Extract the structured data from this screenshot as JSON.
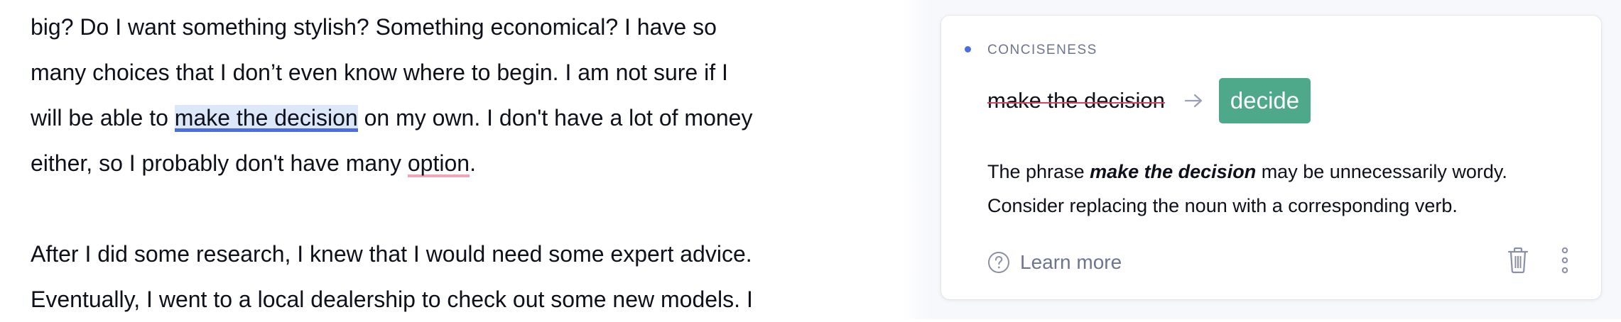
{
  "editor": {
    "paragraph1": {
      "line1": "big? Do I want something stylish? Something economical? I have so",
      "line2": "many choices that I don’t even know where to begin. I am not sure if I",
      "line3_before": "will be able to ",
      "line3_highlight": "make the decision",
      "line3_after": " on my own. I don't have a lot of money",
      "line4_before": "either, so I probably don't have many ",
      "line4_highlight": "option",
      "line4_after": "."
    },
    "paragraph2": {
      "line1": "After I did some research, I knew that I would need some expert advice.",
      "line2": "Eventually, I went to a local dealership to check out some new models. I"
    }
  },
  "card": {
    "category": "CONCISENESS",
    "category_color": "#4a6ee0",
    "original_text": "make the decision",
    "replacement_text": "decide",
    "replacement_color": "#4ea88a",
    "explanation_prefix": "The phrase ",
    "explanation_phrase": "make the decision",
    "explanation_suffix": " may be unnecessarily wordy.",
    "explanation_line2": "Consider replacing the noun with a corresponding verb.",
    "learn_more_label": "Learn more",
    "icons": {
      "arrow": "arrow-right-icon",
      "help": "question-circle-icon",
      "delete": "trash-icon",
      "more": "more-vertical-icon"
    }
  }
}
